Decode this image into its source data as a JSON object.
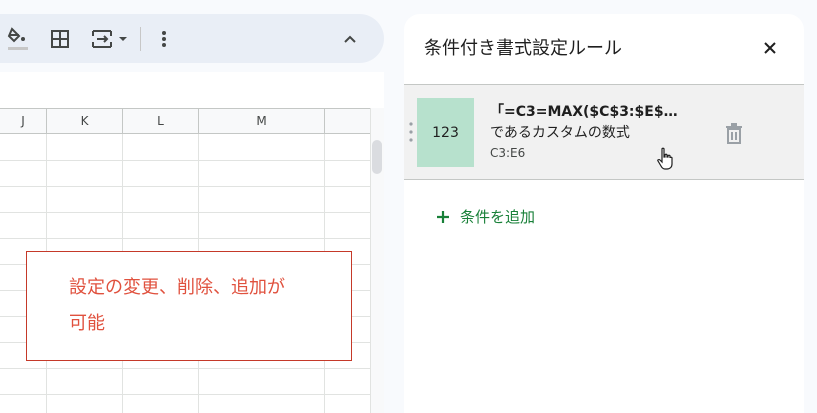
{
  "toolbar": {
    "fill_color_icon": "paint-bucket-icon",
    "borders_icon": "borders-icon",
    "merge_icon": "merge-cells-icon",
    "more_icon": "more-vert-icon",
    "collapse_icon": "chevron-up-icon"
  },
  "sheet": {
    "columns": [
      "J",
      "K",
      "L",
      "M"
    ]
  },
  "callout": {
    "text": "設定の変更、削除、追加が\n可能"
  },
  "panel": {
    "title": "条件付き書式設定ルール",
    "rule": {
      "preview_text": "123",
      "formula": "「=C3=MAX($C$3:$E$…",
      "description": "であるカスタムの数式",
      "range": "C3:E6",
      "preview_color": "#b7e1cd"
    },
    "add_label": "条件を追加"
  },
  "colors": {
    "accent_green": "#188038",
    "callout_red": "#e0513e"
  }
}
